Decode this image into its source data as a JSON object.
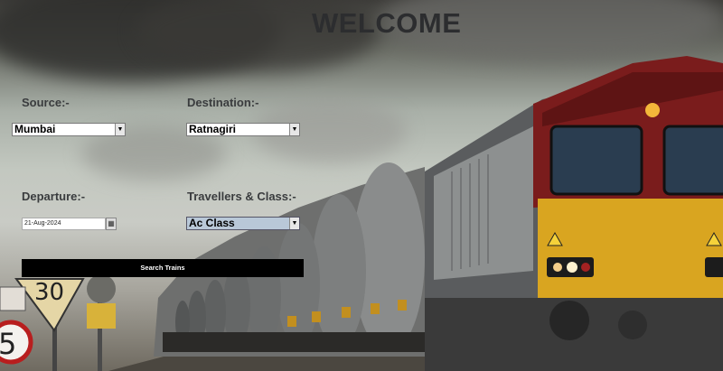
{
  "page": {
    "title": "WELCOME"
  },
  "form": {
    "source": {
      "label": "Source:-",
      "value": "Mumbai"
    },
    "destination": {
      "label": "Destination:-",
      "value": "Ratnagiri"
    },
    "departure": {
      "label": "Departure:-",
      "value": "21-Aug-2024"
    },
    "travellers_class": {
      "label": "Travellers & Class:-",
      "value": "Ac Class"
    },
    "search_button": "Search Trains"
  },
  "signage": {
    "speed_limit": "30",
    "number_sign": "5"
  },
  "colors": {
    "button_bg": "#000000",
    "selected_highlight": "#b9c8d8",
    "title_text": "#2c2d2f",
    "locomotive_yellow": "#d9a520",
    "locomotive_red": "#7a1c1c"
  },
  "icons": {
    "dropdown": "chevron-down-icon",
    "calendar": "calendar-icon"
  }
}
